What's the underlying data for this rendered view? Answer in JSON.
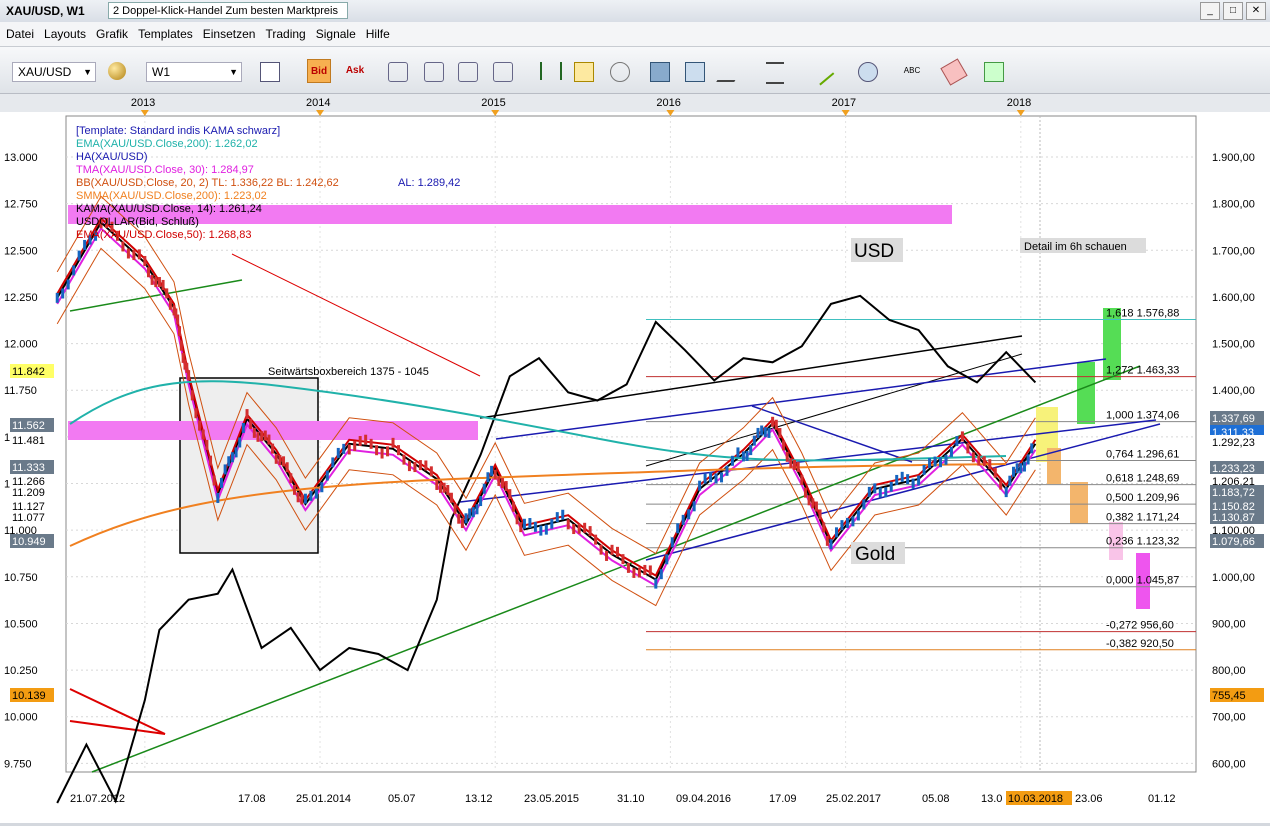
{
  "window": {
    "title": "XAU/USD, W1",
    "tab_label": "2 Doppel-Klick-Handel Zum besten Marktpreis"
  },
  "menu": [
    "Datei",
    "Layouts",
    "Grafik",
    "Templates",
    "Einsetzen",
    "Trading",
    "Signale",
    "Hilfe"
  ],
  "toolbar": {
    "instrument": "XAU/USD",
    "timeframe": "W1",
    "bid_label": "Bid",
    "ask_label": "Ask",
    "text_tool_label": "ABC"
  },
  "chart_data": {
    "type": "line",
    "title": "XAU/USD, W1",
    "colors": {
      "gold_price_up": "#1565c0",
      "gold_price_down": "#d32f2f",
      "usd_index": "#000000",
      "ema200": "#20b2aa",
      "tma30": "#e020e0",
      "bb": "#d05010",
      "smma200": "#f08020",
      "kama14": "#000000",
      "ema50": "#d00000",
      "trend_green": "#1a8a1a",
      "channel_blue": "#1a1ab0"
    },
    "legend": [
      {
        "label": "[Template: Standard indis KAMA schwarz]",
        "color": "#1a1ab0"
      },
      {
        "label": "EMA(XAU/USD.Close,200): 1.262,02",
        "color": "#20b2aa"
      },
      {
        "label": "HA(XAU/USD)",
        "color": "#1a1ab0"
      },
      {
        "label": "TMA(XAU/USD.Close, 30): 1.284,97",
        "color": "#e020e0"
      },
      {
        "label": "BB(XAU/USD.Close, 20, 2)  TL: 1.336,22  BL: 1.242,62",
        "color": "#d05010"
      },
      {
        "label": "AL: 1.289,42",
        "color": "#1a1ab0"
      },
      {
        "label": "SMMA(XAU/USD.Close,200): 1.223,02",
        "color": "#f08020"
      },
      {
        "label": "KAMA(XAU/USD.Close, 14): 1.261,24",
        "color": "#000000"
      },
      {
        "label": "USDOLLAR(Bid, Schluß)",
        "color": "#000000"
      },
      {
        "label": "EMA(XAU/USD.Close,50): 1.268,83",
        "color": "#d00000"
      }
    ],
    "x_axis_years": [
      "2013",
      "2014",
      "2015",
      "2016",
      "2017",
      "2018"
    ],
    "x_axis_dates": [
      "21.07.2012",
      "17.08",
      "25.01.2014",
      "05.07",
      "13.12",
      "23.05.2015",
      "31.10",
      "09.04.2016",
      "17.09",
      "25.02.2017",
      "05.08",
      "13.0",
      "10.03.2018",
      "23.06",
      "01.12"
    ],
    "left_axis": {
      "label": "USDOLLAR",
      "ticks": [
        "13.000",
        "12.750",
        "12.500",
        "12.250",
        "12.000",
        "11.750",
        "11.500",
        "11.250",
        "11.000",
        "10.750",
        "10.500",
        "10.250",
        "10.000",
        "9.750"
      ],
      "range": [
        9750,
        13000
      ]
    },
    "right_axis": {
      "label": "XAU/USD",
      "ticks": [
        "1.900,00",
        "1.800,00",
        "1.700,00",
        "1.600,00",
        "1.500,00",
        "1.400,00",
        "1.300,00",
        "1.200,00",
        "1.100,00",
        "1.000,00",
        "900,00",
        "800,00",
        "700,00",
        "600,00"
      ],
      "range": [
        600,
        1900
      ]
    },
    "left_tags": [
      {
        "text": "11.842",
        "style": "yellow"
      },
      {
        "text": "11.562",
        "style": "grey"
      },
      {
        "text": "11.481",
        "style": "plain"
      },
      {
        "text": "11.333",
        "style": "grey"
      },
      {
        "text": "11.266",
        "style": "plain"
      },
      {
        "text": "11.209",
        "style": "plain"
      },
      {
        "text": "11.127",
        "style": "plain"
      },
      {
        "text": "11.077",
        "style": "plain"
      },
      {
        "text": "10.949",
        "style": "grey"
      },
      {
        "text": "10.139",
        "style": "orange"
      }
    ],
    "right_tags": [
      {
        "text": "1.337,69",
        "style": "grey"
      },
      {
        "text": "1.311,33",
        "style": "blue"
      },
      {
        "text": "1.292,23",
        "style": "plain"
      },
      {
        "text": "1.233,23",
        "style": "grey"
      },
      {
        "text": "1.206,21",
        "style": "plain"
      },
      {
        "text": "1.183,72",
        "style": "grey"
      },
      {
        "text": "1.150,82",
        "style": "grey"
      },
      {
        "text": "1.130,87",
        "style": "grey"
      },
      {
        "text": "1.079,66",
        "style": "grey"
      },
      {
        "text": "755,45",
        "style": "orange"
      }
    ],
    "fib_levels": [
      {
        "ratio": "1,618",
        "value": "1.576,88",
        "price": 1576.88
      },
      {
        "ratio": "1,272",
        "value": "1.463,33",
        "price": 1463.33
      },
      {
        "ratio": "1,000",
        "value": "1.374,06",
        "price": 1374.06
      },
      {
        "ratio": "0,764",
        "value": "1.296,61",
        "price": 1296.61
      },
      {
        "ratio": "0,618",
        "value": "1.248,69",
        "price": 1248.69
      },
      {
        "ratio": "0,500",
        "value": "1.209,96",
        "price": 1209.96
      },
      {
        "ratio": "0,382",
        "value": "1.171,24",
        "price": 1171.24
      },
      {
        "ratio": "0,236",
        "value": "1.123,32",
        "price": 1123.32
      },
      {
        "ratio": "0,000",
        "value": "1.045,87",
        "price": 1045.87
      },
      {
        "ratio": "-0,272",
        "value": "956,60",
        "price": 956.6
      },
      {
        "ratio": "-0,382",
        "value": "920,50",
        "price": 920.5
      }
    ],
    "annotations": [
      {
        "text": "Seitwärtsboxbereich 1375 - 1045"
      },
      {
        "text": "USD"
      },
      {
        "text": "Gold"
      },
      {
        "text": "Detail im 6h schauen"
      }
    ],
    "current_date_label": "10.03.2018",
    "usd_index_series": {
      "x": [
        "2012-07",
        "2012-09",
        "2012-11",
        "2013-01",
        "2013-02",
        "2013-04",
        "2013-06",
        "2013-07",
        "2013-09",
        "2013-11",
        "2014-01",
        "2014-03",
        "2014-05",
        "2014-07",
        "2014-09",
        "2014-10",
        "2014-12",
        "2015-02",
        "2015-04",
        "2015-06",
        "2015-08",
        "2015-10",
        "2015-12",
        "2016-02",
        "2016-04",
        "2016-06",
        "2016-08",
        "2016-10",
        "2016-12",
        "2017-02",
        "2017-04",
        "2017-06",
        "2017-08",
        "2017-10",
        "2017-12",
        "2018-02"
      ],
      "values": [
        9790,
        10080,
        9800,
        10300,
        10650,
        10800,
        10830,
        10950,
        10560,
        10660,
        10450,
        10560,
        10530,
        10450,
        10800,
        11200,
        11520,
        11910,
        12000,
        11830,
        11790,
        11870,
        12180,
        12040,
        11890,
        12000,
        11980,
        12060,
        12270,
        12310,
        12190,
        12140,
        11960,
        11880,
        12030,
        11880
      ]
    },
    "gold_series": {
      "x": [
        "2012-07",
        "2012-10",
        "2013-01",
        "2013-03",
        "2013-04",
        "2013-06",
        "2013-08",
        "2013-10",
        "2013-12",
        "2014-03",
        "2014-06",
        "2014-09",
        "2014-11",
        "2015-01",
        "2015-03",
        "2015-06",
        "2015-09",
        "2015-12",
        "2016-03",
        "2016-06",
        "2016-08",
        "2016-10",
        "2016-12",
        "2017-03",
        "2017-06",
        "2017-09",
        "2017-12",
        "2018-02"
      ],
      "values": [
        1620,
        1770,
        1690,
        1600,
        1460,
        1230,
        1380,
        1310,
        1210,
        1330,
        1320,
        1260,
        1170,
        1280,
        1160,
        1180,
        1110,
        1060,
        1240,
        1310,
        1370,
        1260,
        1130,
        1240,
        1260,
        1340,
        1240,
        1330
      ]
    }
  }
}
